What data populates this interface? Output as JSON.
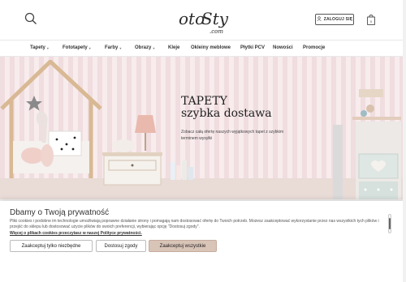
{
  "header": {
    "logo_text": "otoStyl.com",
    "login_label": "ZALOGUJ SIĘ"
  },
  "nav": {
    "items": [
      {
        "label": "Tapety",
        "has_dropdown": true
      },
      {
        "label": "Fototapety",
        "has_dropdown": true
      },
      {
        "label": "Farby",
        "has_dropdown": true
      },
      {
        "label": "Obrazy",
        "has_dropdown": true
      },
      {
        "label": "Kleje",
        "has_dropdown": false
      },
      {
        "label": "Okleiny meblowe",
        "has_dropdown": false
      },
      {
        "label": "Płytki PCV",
        "has_dropdown": false
      },
      {
        "label": "Nowości",
        "has_dropdown": false
      },
      {
        "label": "Promocje",
        "has_dropdown": false
      }
    ]
  },
  "hero": {
    "title_line1": "TAPETY",
    "title_line2": "szybka dostawa",
    "description": "Zobacz całą ofertę naszych wyjątkowych tapet z szybkim terminem wysyłki"
  },
  "cookie": {
    "title": "Dbamy o Twoją prywatność",
    "text": "Pliki cookies i podobne im technologie umożliwiają poprawne działanie strony i pomagają nam dostosować ofertę do Twoich potrzeb. Możesz zaakceptować wykorzystanie przez nas wszystkich tych plików i przejść do sklepu lub dostosować użycie plików do swoich preferencji, wybierając opcję \"Dostosuj zgody\".",
    "link": "Więcej o plikach cookies przeczytasz w naszej Polityce prywatności.",
    "buttons": {
      "necessary": "Zaakceptuj tylko niezbędne",
      "customize": "Dostosuj zgody",
      "accept_all": "Zaakceptuj wszystkie"
    }
  },
  "colors": {
    "accent_button": "#d9c4b8",
    "stripe_pink": "#f0dde0",
    "stripe_light": "#f8eced"
  }
}
